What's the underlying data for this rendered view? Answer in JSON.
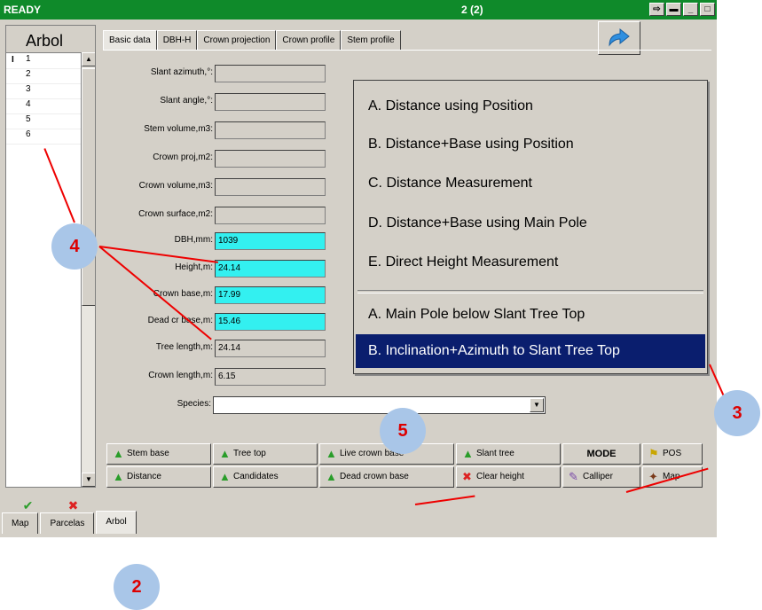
{
  "window": {
    "status": "READY",
    "counter": "2 (2)"
  },
  "tree_list": {
    "header": "Arbol",
    "rows": [
      "1",
      "2",
      "3",
      "4",
      "5",
      "6"
    ]
  },
  "tabs": [
    "Basic data",
    "DBH-H",
    "Crown projection",
    "Crown profile",
    "Stem profile"
  ],
  "fields": [
    {
      "label": "Slant azimuth,°:",
      "value": ""
    },
    {
      "label": "Slant angle,°:",
      "value": ""
    },
    {
      "label": "Stem volume,m3:",
      "value": ""
    },
    {
      "label": "Crown proj,m2:",
      "value": ""
    },
    {
      "label": "Crown volume,m3:",
      "value": ""
    },
    {
      "label": "Crown surface,m2:",
      "value": ""
    },
    {
      "label": "DBH,mm:",
      "value": "1039"
    },
    {
      "label": "Height,m:",
      "value": "24.14"
    },
    {
      "label": "Crown base,m:",
      "value": "17.99"
    },
    {
      "label": "Dead cr base,m:",
      "value": "15.46"
    },
    {
      "label": "Tree length,m:",
      "value": "24.14"
    },
    {
      "label": "Crown length,m:",
      "value": "6.15"
    }
  ],
  "species": {
    "label": "Species:",
    "value": ""
  },
  "popup": {
    "group1": [
      "A. Distance using Position",
      "B. Distance+Base using Position",
      "C. Distance Measurement",
      "D. Distance+Base using Main Pole",
      "E. Direct Height Measurement"
    ],
    "group2": [
      "A. Main Pole below Slant Tree Top",
      "B. Inclination+Azimuth to Slant Tree Top"
    ]
  },
  "buttons": {
    "stem_base": "Stem base",
    "tree_top": "Tree top",
    "live_crown_base": "Live crown base",
    "slant_tree": "Slant tree",
    "mode": "MODE",
    "pos": "POS",
    "distance": "Distance",
    "candidates": "Candidates",
    "dead_crown_base": "Dead crown base",
    "clear_height": "Clear height",
    "calliper": "Calliper",
    "map": "Map"
  },
  "bottom_tabs": [
    "Map",
    "Parcelas",
    "Arbol"
  ],
  "callouts": {
    "two": "2",
    "three": "3",
    "four": "4",
    "five": "5"
  },
  "colors": {
    "titlebar": "#0f8a2a",
    "input_highlight": "#33f0f0",
    "selection": "#0a1e6e",
    "callout": "#a9c6e8",
    "annotation": "#e00000"
  }
}
